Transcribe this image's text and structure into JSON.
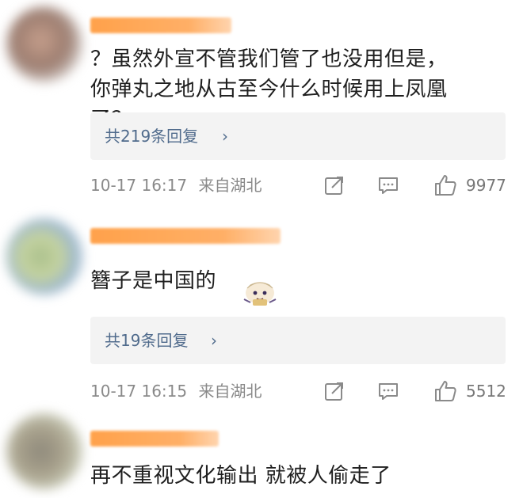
{
  "comments": [
    {
      "text": "？虽然外宣不管我们管了也没用但是，你弹丸之地从古至今什么时候用上凤凰了？",
      "replies_label": "共219条回复",
      "chevron": "›",
      "timestamp": "10-17 16:17",
      "location": "来自湖北",
      "likes": "9977"
    },
    {
      "text": "簪子是中国的",
      "replies_label": "共19条回复",
      "chevron": "›",
      "timestamp": "10-17 16:15",
      "location": "来自湖北",
      "likes": "5512"
    },
    {
      "text": "再不重视文化输出 就被人偷走了"
    }
  ],
  "icons": {
    "share": "share-icon",
    "comment": "comment-icon",
    "like": "thumbs-up-icon",
    "sticker": "paimon-sticker-icon"
  },
  "colors": {
    "link": "#506b8c",
    "meta": "#8a8a8a",
    "username_redaction": "#ff9a3c",
    "reply_box": "#f3f3f3"
  }
}
